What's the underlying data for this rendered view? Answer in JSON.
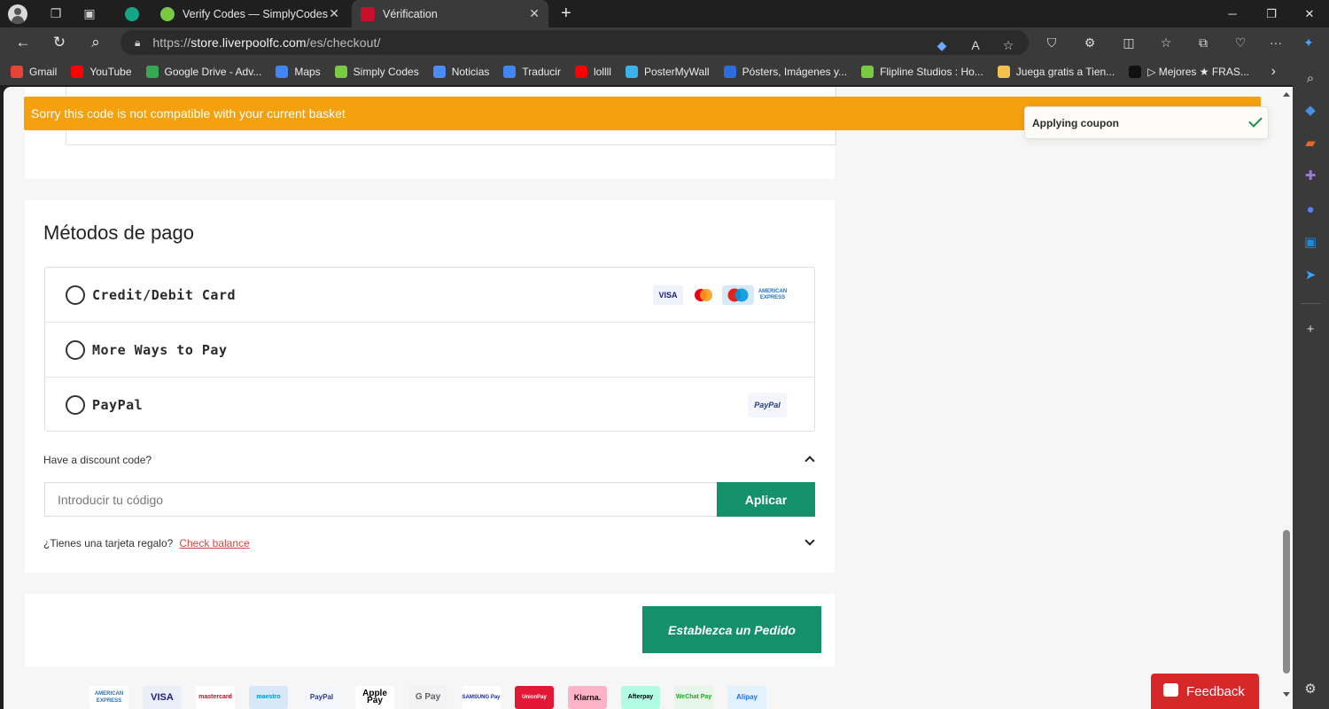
{
  "browser": {
    "tabs": [
      {
        "label": "Verify Codes — SimplyCodes",
        "icon": "simplycodes-icon",
        "active": false
      },
      {
        "label": "Vérification",
        "icon": "liverpool-icon",
        "active": true
      }
    ],
    "url_prefix": "https://",
    "url_host": "store.liverpoolfc.com",
    "url_path": "/es/checkout/",
    "bookmarks": [
      {
        "label": "Gmail",
        "color": "#ea4335"
      },
      {
        "label": "YouTube",
        "color": "#ff0000"
      },
      {
        "label": "Google Drive - Adv...",
        "color": "#34a853"
      },
      {
        "label": "Maps",
        "color": "#4285f4"
      },
      {
        "label": "Simply Codes",
        "color": "#7ac943"
      },
      {
        "label": "Noticias",
        "color": "#4c8bf5"
      },
      {
        "label": "Traducir",
        "color": "#4285f4"
      },
      {
        "label": "lollll",
        "color": "#ff0000"
      },
      {
        "label": "PosterMyWall",
        "color": "#3bb2e8"
      },
      {
        "label": "Pósters, Imágenes y...",
        "color": "#2d6cdf"
      },
      {
        "label": "Flipline Studios : Ho...",
        "color": "#7ac943"
      },
      {
        "label": "Juega gratis a Tien...",
        "color": "#f2c14e"
      },
      {
        "label": "▷ Mejores ★ FRAS...",
        "color": "#111111"
      }
    ]
  },
  "alert": {
    "message": "Sorry this code is not compatible with your current basket",
    "color": "#f5a00d"
  },
  "toast": {
    "message": "Applying coupon"
  },
  "payment": {
    "title": "Métodos de pago",
    "methods": [
      {
        "label": "Credit/Debit Card",
        "logos": [
          "VISA",
          "mastercard",
          "maestro",
          "AMERICAN EXPRESS"
        ]
      },
      {
        "label": "More Ways to Pay",
        "logos": []
      },
      {
        "label": "PayPal",
        "logos": [
          "PayPal"
        ]
      }
    ]
  },
  "discount": {
    "label": "Have a discount code?",
    "placeholder": "Introducir tu código",
    "value": "",
    "apply_label": "Aplicar"
  },
  "gift": {
    "label": "¿Tienes una tarjeta regalo?",
    "link": "Check balance"
  },
  "order_button": "Establezca un Pedido",
  "footer_logos": [
    "AMERICAN EXPRESS",
    "VISA",
    "mastercard",
    "maestro",
    "PayPal",
    "Apple Pay",
    "G Pay",
    "SAMSUNG Pay",
    "UnionPay",
    "Klarna.",
    "Afterpay",
    "WeChat Pay",
    "Alipay"
  ],
  "feedback_label": "Feedback",
  "colors": {
    "brand_green": "#14906a",
    "alert_orange": "#f5a00d",
    "feedback_red": "#d62828"
  }
}
